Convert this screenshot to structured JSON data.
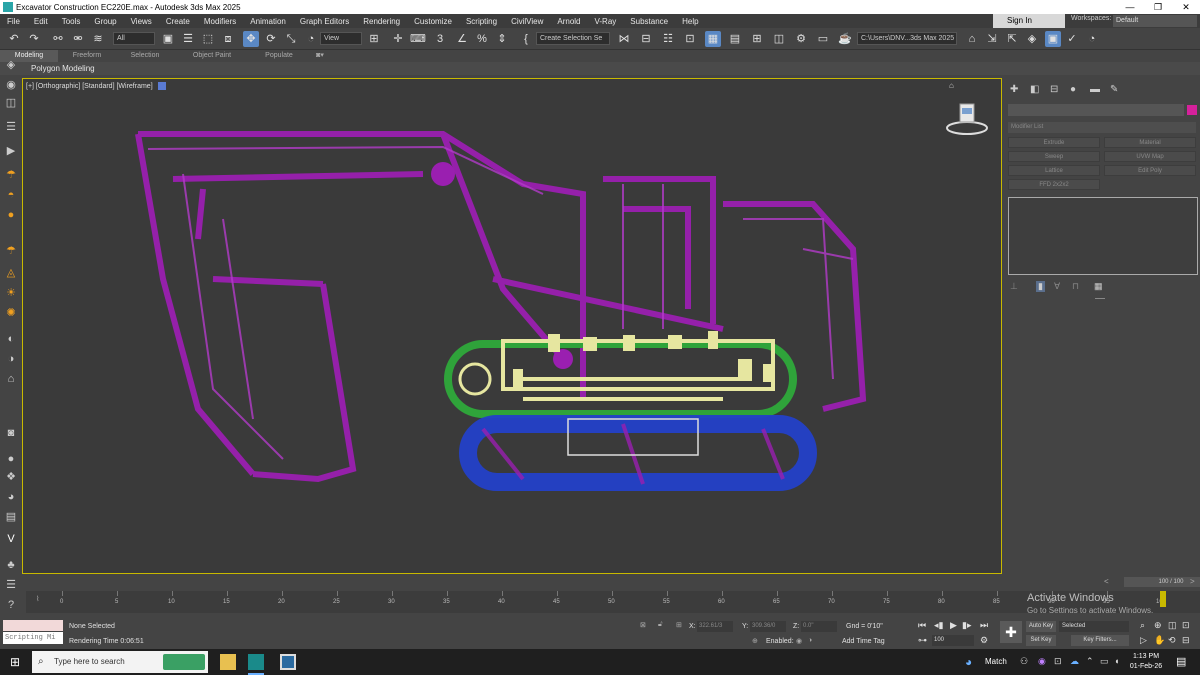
{
  "window": {
    "title": "Excavator Construction EC220E.max - Autodesk 3ds Max 2025",
    "minimize": "—",
    "maximize": "❐",
    "close": "✕"
  },
  "menu": {
    "items": [
      "File",
      "Edit",
      "Tools",
      "Group",
      "Views",
      "Create",
      "Modifiers",
      "Animation",
      "Graph Editors",
      "Rendering",
      "Customize",
      "Scripting",
      "CivilView",
      "Arnold",
      "V-Ray",
      "Substance",
      "Help"
    ],
    "sign_in": "Sign In",
    "workspaces_label": "Workspaces:",
    "workspaces_value": "Default"
  },
  "toolbar": {
    "selection_filter": "All",
    "ref_coord": "View",
    "named_selection": "Create Selection Se",
    "project_path": "C:\\Users\\DNV...3ds Max 2025"
  },
  "ribbon": {
    "tabs": [
      "Modeling",
      "Freeform",
      "Selection",
      "Object Paint",
      "Populate"
    ],
    "active_tab": "Modeling",
    "panel_label": "Polygon Modeling"
  },
  "viewport": {
    "label": "[+] [Orthographic] [Standard] [Wireframe]"
  },
  "command_panel": {
    "modifier_list": "Modifier List",
    "buttons": [
      "Extrude",
      "Material",
      "Sweep",
      "UVW Map",
      "Lattice",
      "Edit Poly",
      "FFD 2x2x2"
    ],
    "object_color": "#d6219c"
  },
  "timeline": {
    "frame_display": "100 / 100",
    "ticks": [
      "0",
      "5",
      "10",
      "15",
      "20",
      "25",
      "30",
      "35",
      "40",
      "45",
      "50",
      "55",
      "60",
      "65",
      "70",
      "75",
      "80",
      "85",
      "90",
      "95",
      "100"
    ]
  },
  "activation": {
    "line1": "Activate Windows",
    "line2": "Go to Settings to activate Windows."
  },
  "status": {
    "script_label": "Scripting Mi",
    "selection": "None Selected",
    "render_time": "Rendering Time  0:06:51",
    "x_label": "X:",
    "x_value": "322.61/3",
    "y_label": "Y:",
    "y_value": "309.36/0",
    "z_label": "Z:",
    "z_value": "0.0\"",
    "grid": "Gnd = 0'10\"",
    "enabled": "Enabled:",
    "add_time_tag": "Add Time Tag",
    "auto_key": "Auto Key",
    "set_key": "Set Key",
    "selected": "Selected",
    "key_filters": "Key Filters...",
    "frame": "100"
  },
  "taskbar": {
    "search_placeholder": "Type here to search",
    "weather": "Match",
    "time": "1:13 PM",
    "date": "01-Feb-26"
  }
}
